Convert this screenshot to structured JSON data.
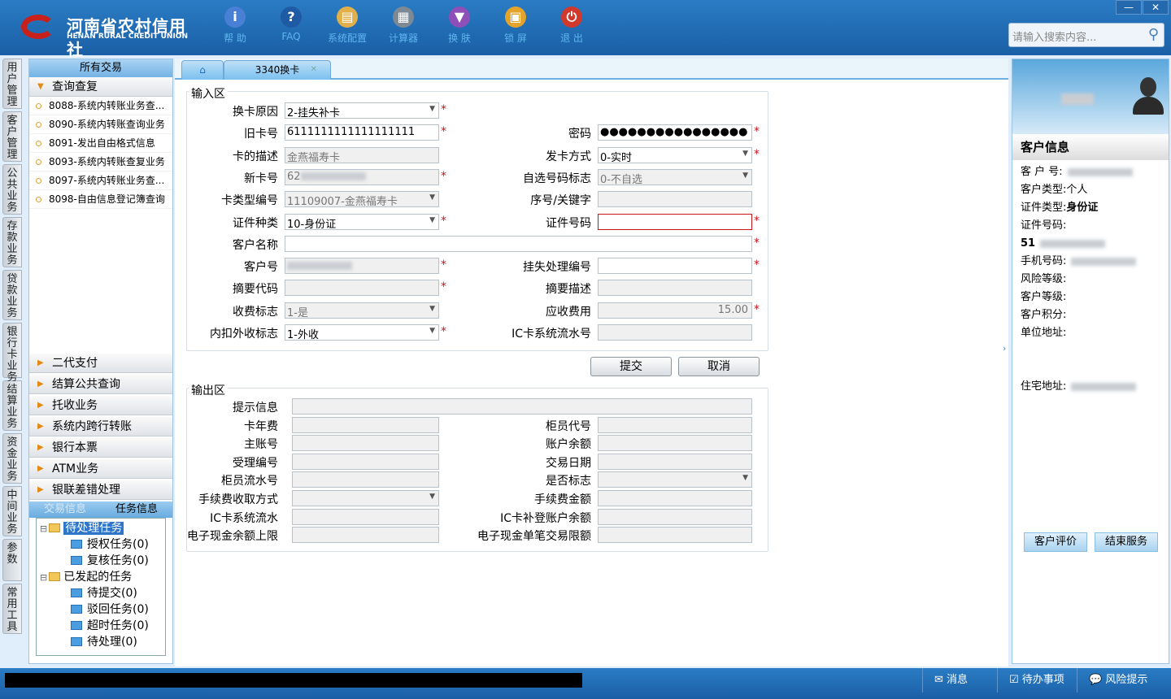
{
  "header": {
    "logo_cn": "河南省农村信用社",
    "logo_en": "HENAN RURAL CREDIT UNION",
    "tools": [
      {
        "label": "帮 助",
        "icon": "info-icon",
        "color": "#4a7fd6",
        "glyph": "i"
      },
      {
        "label": "FAQ",
        "icon": "question-icon",
        "color": "#1f5aa5",
        "glyph": "?"
      },
      {
        "label": "系统配置",
        "icon": "toolbox-icon",
        "color": "#e2b04a",
        "glyph": "▤"
      },
      {
        "label": "计算器",
        "icon": "calculator-icon",
        "color": "#7d8a96",
        "glyph": "▦"
      },
      {
        "label": "换 肤",
        "icon": "shirt-icon",
        "color": "#8e4fb8",
        "glyph": "▼"
      },
      {
        "label": "锁 屏",
        "icon": "lock-icon",
        "color": "#e4a32a",
        "glyph": "▣"
      },
      {
        "label": "退 出",
        "icon": "power-icon",
        "color": "#d0392b",
        "glyph": "⏻"
      }
    ],
    "search_placeholder": "请输入搜索内容..."
  },
  "vtabs": [
    "用户管理",
    "客户管理",
    "公共业务",
    "存款业务",
    "贷款业务",
    "银行卡业务",
    "结算业务",
    "资金业务",
    "中间业务",
    "参数",
    "常用工具"
  ],
  "sidebar": {
    "title": "所有交易",
    "open_group": "查询查复",
    "items": [
      "8088-系统内转账业务查...",
      "8090-系统内转账查询业务",
      "8091-发出自由格式信息",
      "8093-系统内转账查复业务",
      "8097-系统内转账业务查...",
      "8098-自由信息登记簿查询"
    ],
    "groups": [
      "二代支付",
      "结算公共查询",
      "托收业务",
      "系统内跨行转账",
      "银行本票",
      "ATM业务",
      "银联差错处理"
    ],
    "bottom_tabs": [
      "交易信息",
      "任务信息"
    ],
    "tree": [
      {
        "label": "待处理任务",
        "level": 0,
        "folder": true,
        "selected": true
      },
      {
        "label": "授权任务(0)",
        "level": 1
      },
      {
        "label": "复核任务(0)",
        "level": 1
      },
      {
        "label": "已发起的任务",
        "level": 0,
        "folder": true
      },
      {
        "label": "待提交(0)",
        "level": 1
      },
      {
        "label": "驳回任务(0)",
        "level": 1
      },
      {
        "label": "超时任务(0)",
        "level": 1
      },
      {
        "label": "待处理(0)",
        "level": 1
      }
    ]
  },
  "tabs": {
    "active": "3340换卡"
  },
  "input": {
    "legend": "输入区",
    "fields": [
      {
        "label": "换卡原因",
        "value": "2-挂失补卡",
        "col": 0,
        "row": 0,
        "dd": true,
        "white": true,
        "req": true
      },
      {
        "label": "旧卡号",
        "value": "6111111111111111111",
        "col": 0,
        "row": 1,
        "white": true,
        "req": true
      },
      {
        "label": "密码",
        "value": "●●●●●●●●●●●●●●●●",
        "col": 1,
        "row": 1,
        "white": true,
        "req": true
      },
      {
        "label": "卡的描述",
        "value": "金燕福寿卡",
        "col": 0,
        "row": 2
      },
      {
        "label": "发卡方式",
        "value": "0-实时",
        "col": 1,
        "row": 2,
        "dd": true,
        "white": true,
        "req": true
      },
      {
        "label": "新卡号",
        "value": "62",
        "col": 0,
        "row": 3,
        "req": true,
        "blur": true
      },
      {
        "label": "自选号码标志",
        "value": "0-不自选",
        "col": 1,
        "row": 3,
        "dd": true
      },
      {
        "label": "卡类型编号",
        "value": "11109007-金燕福寿卡",
        "col": 0,
        "row": 4,
        "dd": true
      },
      {
        "label": "序号/关键字",
        "value": "",
        "col": 1,
        "row": 4
      },
      {
        "label": "证件种类",
        "value": "10-身份证",
        "col": 0,
        "row": 5,
        "dd": true,
        "white": true,
        "req": true
      },
      {
        "label": "证件号码",
        "value": "",
        "col": 1,
        "row": 5,
        "err": true,
        "req": true
      },
      {
        "label": "客户名称",
        "value": "",
        "col": 0,
        "row": 6,
        "wide": true,
        "white": true,
        "req": true
      },
      {
        "label": "客户号",
        "value": "",
        "col": 0,
        "row": 7,
        "req": true,
        "blur": true
      },
      {
        "label": "挂失处理编号",
        "value": "",
        "col": 1,
        "row": 7,
        "white": true,
        "req": true
      },
      {
        "label": "摘要代码",
        "value": "",
        "col": 0,
        "row": 8,
        "req": true
      },
      {
        "label": "摘要描述",
        "value": "",
        "col": 1,
        "row": 8
      },
      {
        "label": "收费标志",
        "value": "1-是",
        "col": 0,
        "row": 9,
        "dd": true
      },
      {
        "label": "应收费用",
        "value": "15.00",
        "col": 1,
        "row": 9,
        "req": true,
        "num": true
      },
      {
        "label": "内扣外收标志",
        "value": "1-外收",
        "col": 0,
        "row": 10,
        "dd": true,
        "white": true,
        "req": true
      },
      {
        "label": "IC卡系统流水号",
        "value": "",
        "col": 1,
        "row": 10
      }
    ]
  },
  "buttons": {
    "submit": "提交",
    "cancel": "取消"
  },
  "output": {
    "legend": "输出区",
    "fields": [
      {
        "label": "提示信息",
        "col": 0,
        "row": 0,
        "wide": true
      },
      {
        "label": "卡年费",
        "col": 0,
        "row": 1
      },
      {
        "label": "柜员代号",
        "col": 1,
        "row": 1
      },
      {
        "label": "主账号",
        "col": 0,
        "row": 2
      },
      {
        "label": "账户余额",
        "col": 1,
        "row": 2
      },
      {
        "label": "受理编号",
        "col": 0,
        "row": 3
      },
      {
        "label": "交易日期",
        "col": 1,
        "row": 3
      },
      {
        "label": "柜员流水号",
        "col": 0,
        "row": 4
      },
      {
        "label": "是否标志",
        "col": 1,
        "row": 4,
        "dd": true
      },
      {
        "label": "手续费收取方式",
        "col": 0,
        "row": 5,
        "dd": true
      },
      {
        "label": "手续费金额",
        "col": 1,
        "row": 5
      },
      {
        "label": "IC卡系统流水",
        "col": 0,
        "row": 6
      },
      {
        "label": "IC卡补登账户余额",
        "col": 1,
        "row": 6
      },
      {
        "label": "电子现金余额上限",
        "col": 0,
        "row": 7
      },
      {
        "label": "电子现金单笔交易限额",
        "col": 1,
        "row": 7
      }
    ]
  },
  "customer": {
    "title": "客户信息",
    "rows": [
      {
        "k": "客 户 号:",
        "v": "",
        "blur": true
      },
      {
        "k": "客户类型:",
        "v": "个人"
      },
      {
        "k": "证件类型:",
        "v": "身份证",
        "bold": true
      },
      {
        "k": "证件号码:",
        "v": ""
      },
      {
        "k": "",
        "v": "51",
        "bold": true,
        "blur": true
      },
      {
        "k": "手机号码:",
        "v": "",
        "blur": true
      },
      {
        "k": "风险等级:",
        "v": ""
      },
      {
        "k": "客户等级:",
        "v": ""
      },
      {
        "k": "客户积分:",
        "v": ""
      },
      {
        "k": "单位地址:",
        "v": ""
      },
      {
        "k": "",
        "v": ""
      },
      {
        "k": "",
        "v": ""
      },
      {
        "k": "住宅地址:",
        "v": "",
        "blur": true
      }
    ],
    "eval": "客户评价",
    "end": "结束服务"
  },
  "status": {
    "msg": "消息",
    "todo": "待办事项",
    "risk": "风险提示"
  }
}
